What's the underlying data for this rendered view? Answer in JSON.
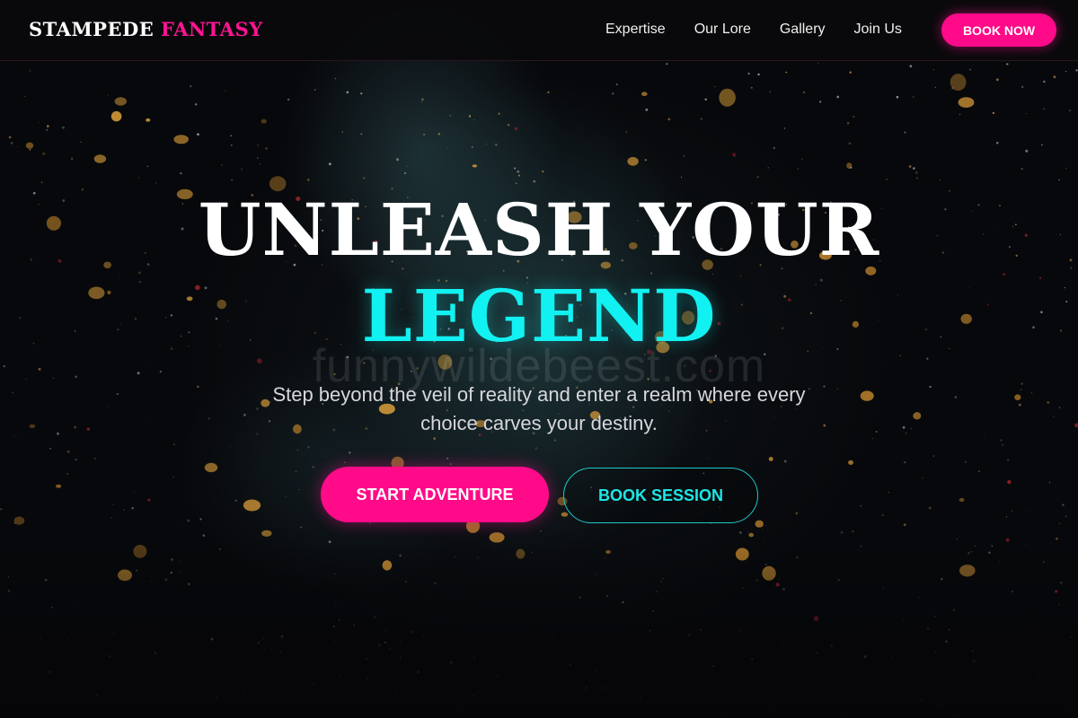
{
  "navbar": {
    "logo_main": "STAMPEDE",
    "logo_accent": "FANTASY",
    "links": [
      "Expertise",
      "Our Lore",
      "Gallery",
      "Join Us"
    ],
    "cta": "BOOK NOW"
  },
  "hero": {
    "headline_line1": "UNLEASH YOUR",
    "headline_line2": "LEGEND",
    "watermark": "funnywildebeest.com",
    "subtitle": "Step beyond the veil of reality and enter a realm where every choice carves your destiny.",
    "primary_button": "START ADVENTURE",
    "secondary_button": "BOOK SESSION"
  },
  "colors": {
    "accent_pink": "#ff0a88",
    "accent_cyan": "#12f1f1",
    "background": "#07080b"
  }
}
